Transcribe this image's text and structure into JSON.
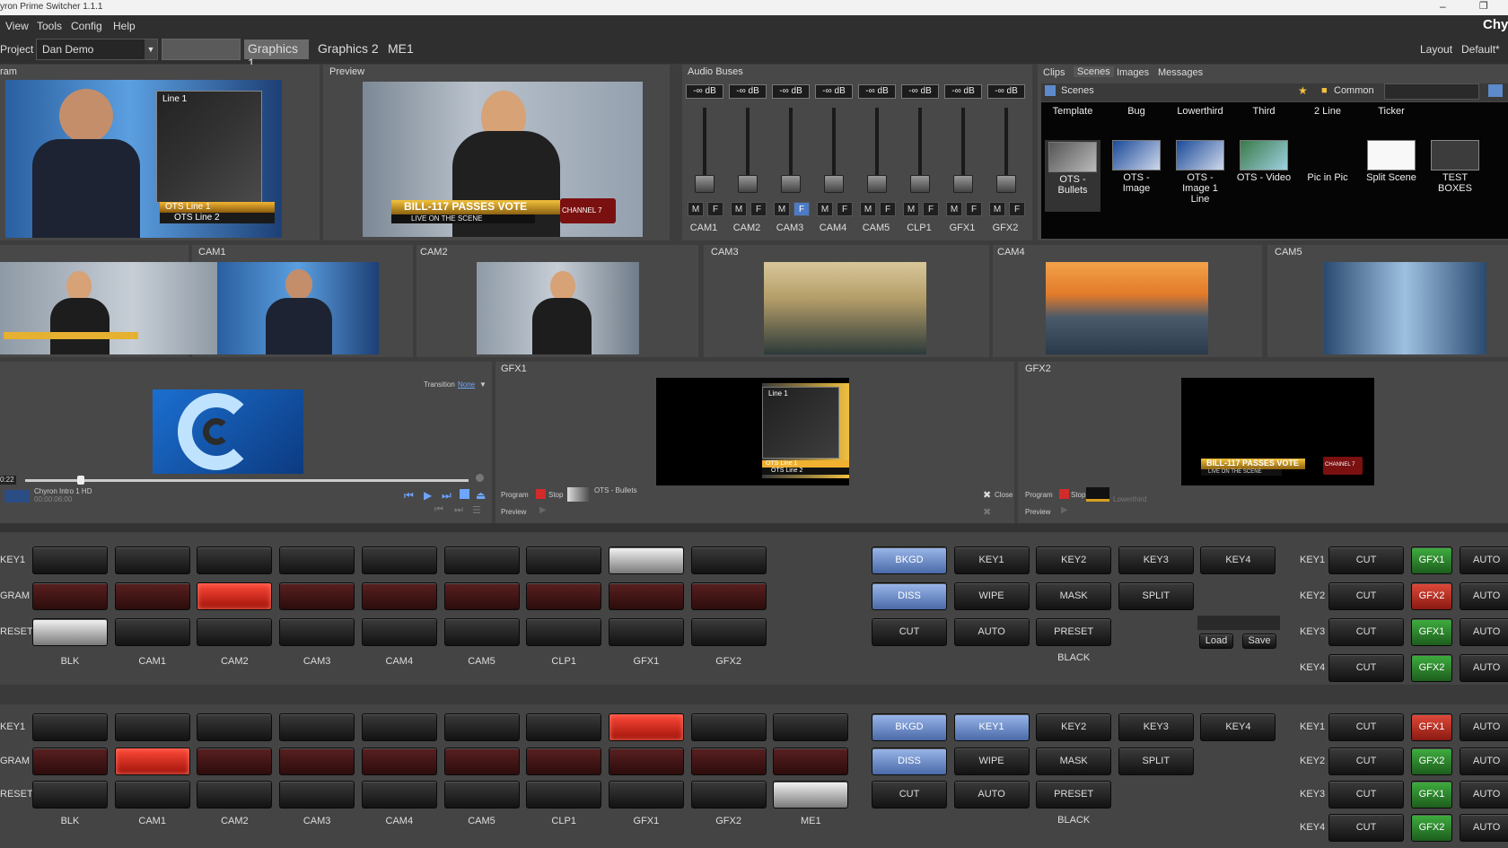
{
  "app": {
    "title": "yron Prime Switcher 1.1.1",
    "brand": "Chy"
  },
  "menu": [
    "View",
    "Tools",
    "Config",
    "Help"
  ],
  "toolbar": {
    "project_label": "Project",
    "project_value": "Dan Demo",
    "tabs": [
      "Graphics 1",
      "Graphics 2",
      "ME1"
    ],
    "layout_label": "Layout",
    "layout_value": "Default*"
  },
  "program": {
    "label": "ram",
    "lower_third": [
      "OTS Line 1",
      "OTS Line 2"
    ],
    "inset": "Line 1"
  },
  "preview": {
    "label": "Preview",
    "banner": "BILL-117 PASSES VOTE",
    "sub": "LIVE ON THE SCENE",
    "logo": "CHANNEL 7"
  },
  "audio": {
    "label": "Audio Buses",
    "levels": [
      "-∞ dB",
      "-∞ dB",
      "-∞ dB",
      "-∞ dB",
      "-∞ dB",
      "-∞ dB",
      "-∞ dB",
      "-∞ dB"
    ],
    "channels": [
      "CAM1",
      "CAM2",
      "CAM3",
      "CAM4",
      "CAM5",
      "CLP1",
      "GFX1",
      "GFX2"
    ],
    "m": "M",
    "f": "F"
  },
  "library": {
    "tabs": [
      "Clips",
      "Scenes",
      "Images",
      "Messages"
    ],
    "scenes_label": "Scenes",
    "common_label": "Common",
    "row1": [
      "Template",
      "Bug",
      "Lowerthird",
      "Third",
      "2 Line",
      "Ticker"
    ],
    "row2": [
      "OTS - Bullets",
      "OTS - Image",
      "OTS - Image 1 Line",
      "OTS - Video",
      "Pic in Pic",
      "Split Scene",
      "TEST BOXES"
    ]
  },
  "multiview": [
    "CAM1",
    "CAM2",
    "CAM3",
    "CAM4",
    "CAM5"
  ],
  "clip": {
    "transition_label": "Transition",
    "transition_value": "None",
    "time": "0:22",
    "name": "Chyron Intro 1 HD",
    "tc": "00:00:06:00"
  },
  "gfx1": {
    "label": "GFX1",
    "program": "Program",
    "stop": "Stop",
    "item": "OTS - Bullets",
    "preview": "Preview",
    "close": "Close",
    "inset": "Line 1",
    "lt": [
      "OTS Line 1",
      "OTS Line 2"
    ]
  },
  "gfx2": {
    "label": "GFX2",
    "program": "Program",
    "stop": "Stop",
    "item": "Lowerthird",
    "preview": "Preview",
    "banner": "BILL-117 PASSES VOTE",
    "sub": "LIVE ON THE SCENE",
    "logo": "CHANNEL 7"
  },
  "me1": {
    "row_labels": [
      "KEY1",
      "GRAM",
      "RESET"
    ],
    "sources": [
      "BLK",
      "CAM1",
      "CAM2",
      "CAM3",
      "CAM4",
      "CAM5",
      "CLP1",
      "GFX1",
      "GFX2"
    ],
    "trans": [
      [
        "BKGD",
        "KEY1",
        "KEY2",
        "KEY3",
        "KEY4"
      ],
      [
        "DISS",
        "WIPE",
        "MASK",
        "SPLIT"
      ],
      [
        "CUT",
        "AUTO",
        "PRESET BLACK"
      ]
    ],
    "load": "Load",
    "save": "Save",
    "keys": [
      {
        "label": "KEY1",
        "cut": "CUT",
        "src": "GFX1",
        "auto": "AUTO"
      },
      {
        "label": "KEY2",
        "cut": "CUT",
        "src": "GFX2",
        "auto": "AUTO"
      },
      {
        "label": "KEY3",
        "cut": "CUT",
        "src": "GFX1",
        "auto": "AUTO"
      },
      {
        "label": "KEY4",
        "cut": "CUT",
        "src": "GFX2",
        "auto": "AUTO"
      }
    ]
  },
  "me2": {
    "row_labels": [
      "KEY1",
      "GRAM",
      "RESET"
    ],
    "sources": [
      "BLK",
      "CAM1",
      "CAM2",
      "CAM3",
      "CAM4",
      "CAM5",
      "CLP1",
      "GFX1",
      "GFX2",
      "ME1"
    ],
    "trans": [
      [
        "BKGD",
        "KEY1",
        "KEY2",
        "KEY3",
        "KEY4"
      ],
      [
        "DISS",
        "WIPE",
        "MASK",
        "SPLIT"
      ],
      [
        "CUT",
        "AUTO",
        "PRESET BLACK"
      ]
    ],
    "keys": [
      {
        "label": "KEY1",
        "cut": "CUT",
        "src": "GFX1",
        "auto": "AUTO"
      },
      {
        "label": "KEY2",
        "cut": "CUT",
        "src": "GFX2",
        "auto": "AUTO"
      },
      {
        "label": "KEY3",
        "cut": "CUT",
        "src": "GFX1",
        "auto": "AUTO"
      },
      {
        "label": "KEY4",
        "cut": "CUT",
        "src": "GFX2",
        "auto": "AUTO"
      }
    ]
  }
}
